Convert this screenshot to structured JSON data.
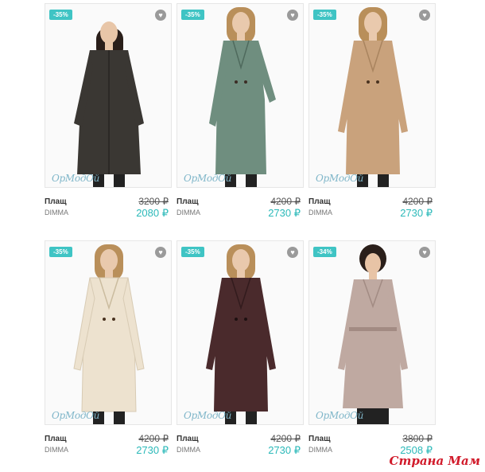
{
  "products": [
    {
      "badge": "-35%",
      "name": "Плащ",
      "brand": "DIMMA",
      "old_price": "3200 ₽",
      "new_price": "2080 ₽",
      "watermark": "ОрМодОй",
      "coat_color": "#3a3733",
      "skin": "#e8c6a8",
      "hair": "#2a1f1a"
    },
    {
      "badge": "-35%",
      "name": "Плащ",
      "brand": "DIMMA",
      "old_price": "4200 ₽",
      "new_price": "2730 ₽",
      "watermark": "ОрМодОй",
      "coat_color": "#6f8e7f",
      "skin": "#e9c9ad",
      "hair": "#b98f5a"
    },
    {
      "badge": "-35%",
      "name": "Плащ",
      "brand": "DIMMA",
      "old_price": "4200 ₽",
      "new_price": "2730 ₽",
      "watermark": "ОрМодОй",
      "coat_color": "#c9a27c",
      "skin": "#e9c9ad",
      "hair": "#b98f5a"
    },
    {
      "badge": "-35%",
      "name": "Плащ",
      "brand": "DIMMA",
      "old_price": "4200 ₽",
      "new_price": "2730 ₽",
      "watermark": "ОрМодОй",
      "coat_color": "#ede2cf",
      "skin": "#e9c9ad",
      "hair": "#b98f5a"
    },
    {
      "badge": "-35%",
      "name": "Плащ",
      "brand": "DIMMA",
      "old_price": "4200 ₽",
      "new_price": "2730 ₽",
      "watermark": "ОрМодОй",
      "coat_color": "#4a2a2c",
      "skin": "#e9c9ad",
      "hair": "#b98f5a"
    },
    {
      "badge": "-34%",
      "name": "Плащ",
      "brand": "DIMMA",
      "old_price": "3800 ₽",
      "new_price": "2508 ₽",
      "watermark": "ОрМодОй",
      "coat_color": "#bfa9a1",
      "skin": "#e8c4a6",
      "hair": "#2a1f1a"
    }
  ],
  "site_logo": "Страна Мам",
  "colors": {
    "badge_bg": "#3fc4c4",
    "price_new": "#2bb9b9",
    "logo": "#d11a2a"
  }
}
